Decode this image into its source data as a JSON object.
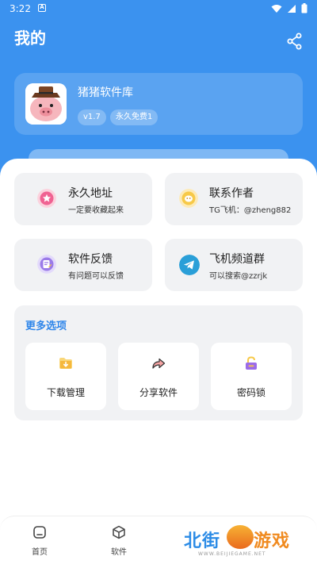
{
  "status_bar": {
    "time": "3:22",
    "notif_icon": "A"
  },
  "header": {
    "title": "我的",
    "share_icon": "share-icon"
  },
  "app": {
    "name": "猪猪软件库",
    "version": "v1.7",
    "badge": "永久免费1",
    "logo_icon": "pig-avatar-icon"
  },
  "tiles": [
    {
      "title": "永久地址",
      "subtitle": "一定要收藏起来",
      "icon": "star-icon",
      "color": "#f06292"
    },
    {
      "title": "联系作者",
      "subtitle": "TG飞机：@zheng882",
      "icon": "face-icon",
      "color": "#f7c948"
    },
    {
      "title": "软件反馈",
      "subtitle": "有问题可以反馈",
      "icon": "feedback-icon",
      "color": "#9b7be8"
    },
    {
      "title": "飞机频道群",
      "subtitle": "可以搜索@zzrjk",
      "icon": "telegram-icon",
      "color": "#2a9fd8"
    }
  ],
  "more": {
    "title": "更多选项",
    "options": [
      {
        "label": "下载管理",
        "icon": "folder-download-icon",
        "color": "#f5b83d"
      },
      {
        "label": "分享软件",
        "icon": "share-arrow-icon",
        "color": "#f08080"
      },
      {
        "label": "密码锁",
        "icon": "lock-icon",
        "color": "#9c6be8"
      }
    ]
  },
  "nav": {
    "items": [
      {
        "label": "首页",
        "icon": "home-icon"
      },
      {
        "label": "软件",
        "icon": "box-icon"
      }
    ]
  },
  "watermark": {
    "text1": "北街",
    "text2": "游戏",
    "url": "WWW.BEIJIEGAME.NET"
  },
  "colors": {
    "primary": "#3b92ef",
    "accent_text": "#2f86ea",
    "tile_bg": "#f1f2f4"
  }
}
